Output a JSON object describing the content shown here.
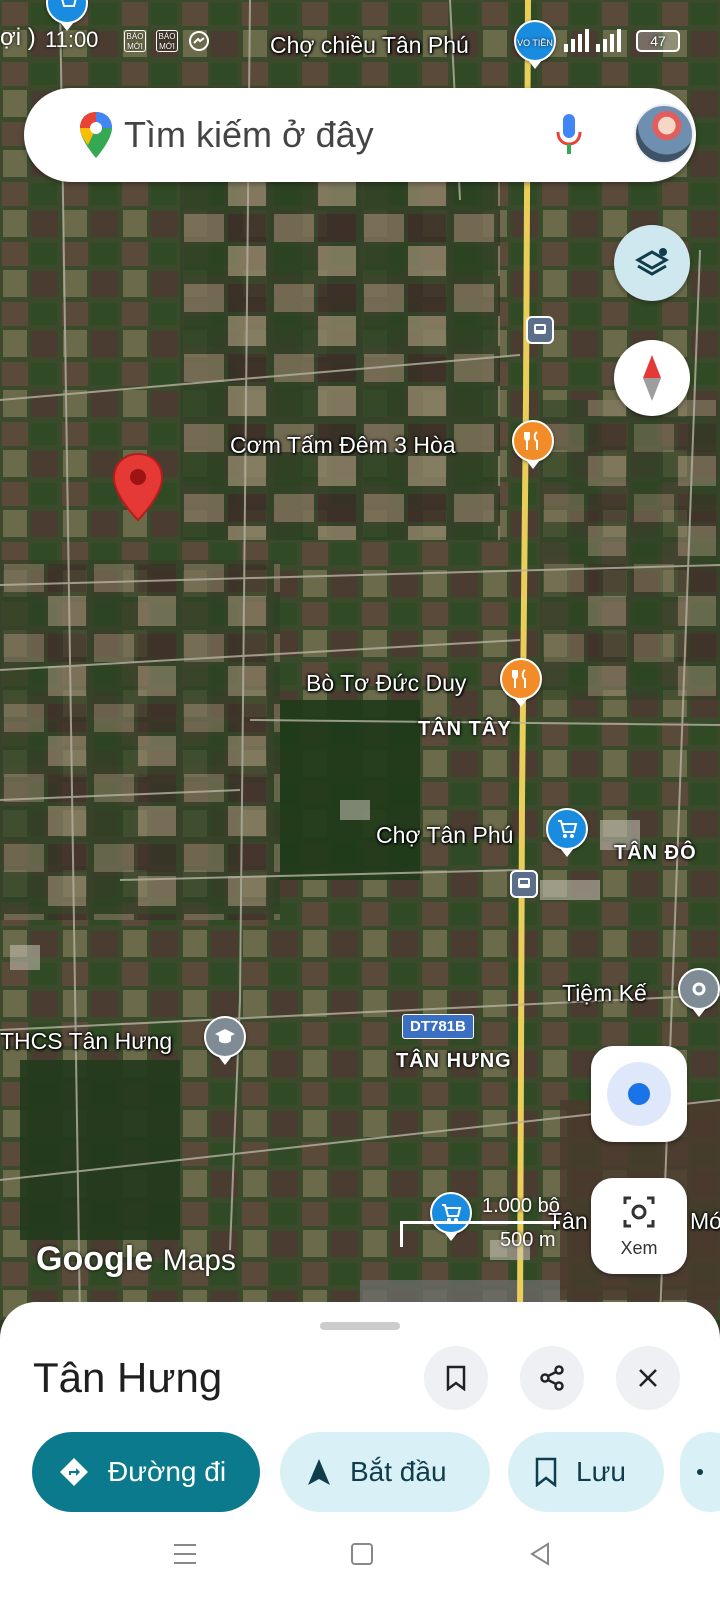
{
  "status_bar": {
    "time": "11:00",
    "left_fragment": "ợi )",
    "battery": "47",
    "icon_bao_1": "BÁO MỚI",
    "icon_bao_2": "BÁO MỚI",
    "vo_tien_badge": "VO TIỀN"
  },
  "search": {
    "placeholder": "Tìm kiếm ở đây"
  },
  "map": {
    "pois": [
      {
        "name": "Chợ chiều Tân Phú",
        "icon": "shopping-cart-icon"
      },
      {
        "name": "Cơm Tấm Đêm 3 Hòa",
        "icon": "restaurant-icon"
      },
      {
        "name": "Bò Tơ Đức Duy",
        "icon": "restaurant-icon"
      },
      {
        "name": "Chợ Tân Phú",
        "icon": "shopping-cart-icon"
      },
      {
        "name": "Tiệm Kế",
        "icon": "place-icon"
      },
      {
        "name": "THCS Tân Hưng",
        "icon": "school-icon"
      },
      {
        "name": "Tân Hoá",
        "icon": "shopping-cart-icon"
      },
      {
        "name": "Mót",
        "icon": "none"
      }
    ],
    "areas": {
      "tan_tay": "TÂN TÂY",
      "tan_dong": "TÂN ĐÔ",
      "tan_hung": "TÂN HƯNG"
    },
    "road_badge": "DT781B",
    "scale": {
      "top": "1.000 bộ",
      "bottom": "500 m"
    },
    "logo_google": "Google",
    "logo_maps": "Maps",
    "selected_pin": "red-location-pin-icon"
  },
  "controls": {
    "layers": "layers-icon",
    "compass": "compass-icon",
    "my_location": "my-location-icon",
    "xem_label": "Xem"
  },
  "sheet": {
    "title": "Tân Hưng",
    "actions": {
      "directions": "Đường đi",
      "start": "Bắt đầu",
      "save": "Lưu"
    }
  },
  "colors": {
    "primary_chip": "#0b7a8c",
    "secondary_chip": "#d9f1f6",
    "restaurant_pin": "#f28c28",
    "shop_pin": "#1a8ce0",
    "selected_pin": "#e53935"
  }
}
